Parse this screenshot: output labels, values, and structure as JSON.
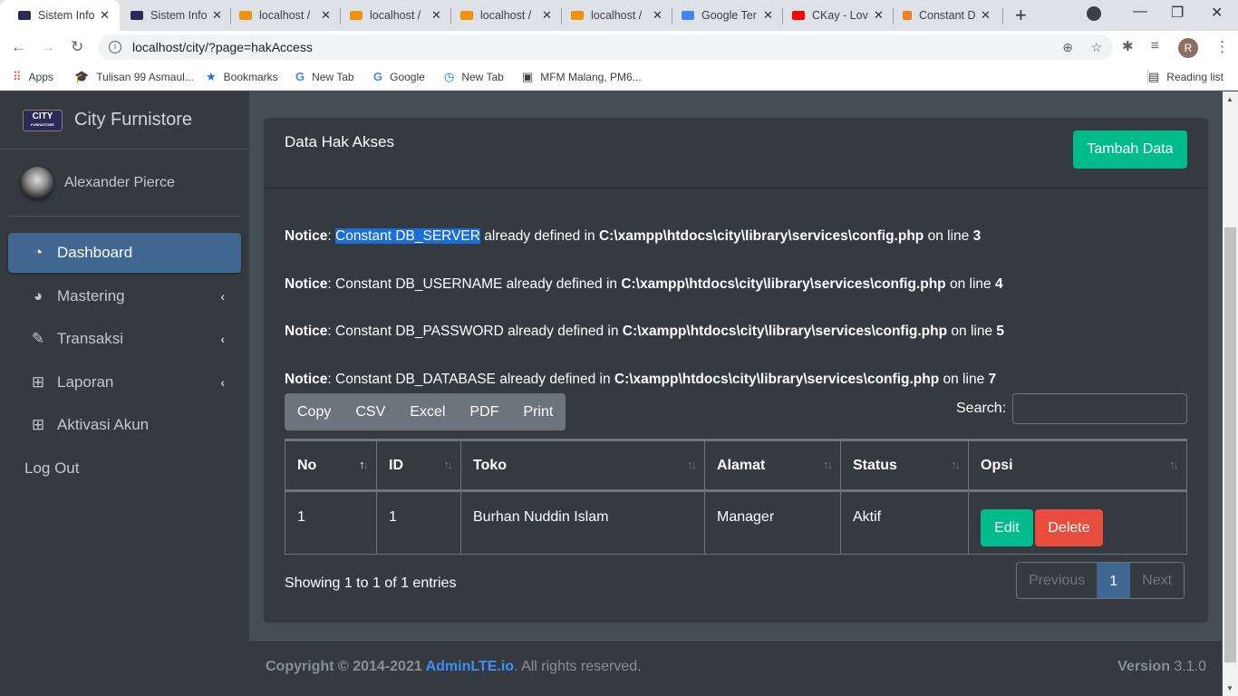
{
  "browser": {
    "tabs": [
      {
        "title": "Sistem Info",
        "icon": "city-favicon",
        "active": true
      },
      {
        "title": "Sistem Info",
        "icon": "city-favicon",
        "active": false
      },
      {
        "title": "localhost /",
        "icon": "pma-favicon",
        "active": false
      },
      {
        "title": "localhost /",
        "icon": "pma-favicon",
        "active": false
      },
      {
        "title": "localhost /",
        "icon": "pma-favicon",
        "active": false
      },
      {
        "title": "localhost /",
        "icon": "pma-favicon",
        "active": false
      },
      {
        "title": "Google Ter",
        "icon": "google-translate-favicon",
        "active": false
      },
      {
        "title": "CKay - Lov",
        "icon": "youtube-favicon",
        "active": false
      },
      {
        "title": "Constant D",
        "icon": "stackoverflow-favicon",
        "active": false
      }
    ],
    "url": "localhost/city/?page=hakAccess",
    "profile_initial": "R",
    "bookmarks": [
      {
        "label": "Apps",
        "icon": "apps-grid-icon"
      },
      {
        "label": "Tulisan 99 Asmaul...",
        "icon": "graduation-cap-icon"
      },
      {
        "label": "Bookmarks",
        "icon": "star-icon"
      },
      {
        "label": "New Tab",
        "icon": "google-icon"
      },
      {
        "label": "Google",
        "icon": "google-icon"
      },
      {
        "label": "New Tab",
        "icon": "history-icon"
      },
      {
        "label": "MFM Malang, PM6...",
        "icon": "site-icon"
      }
    ],
    "reading_list": "Reading list"
  },
  "sidebar": {
    "brand": "City Furnistore",
    "logo_text": "CITY",
    "logo_sub": "FURNISTORE",
    "user": "Alexander Pierce",
    "items": [
      {
        "label": "Dashboard",
        "icon": "tachometer-icon",
        "active": true,
        "has_children": false
      },
      {
        "label": "Mastering",
        "icon": "pie-chart-icon",
        "active": false,
        "has_children": true
      },
      {
        "label": "Transaksi",
        "icon": "edit-icon",
        "active": false,
        "has_children": true
      },
      {
        "label": "Laporan",
        "icon": "table-icon",
        "active": false,
        "has_children": true
      },
      {
        "label": "Aktivasi Akun",
        "icon": "table-icon",
        "active": false,
        "has_children": false
      }
    ],
    "logout": "Log Out"
  },
  "card": {
    "title": "Data Hak Akses",
    "add_button": "Tambah Data"
  },
  "notices": [
    {
      "label": "Notice",
      "pre": "Constant DB_SERVER",
      "msg": " already defined in ",
      "path": "C:\\xampp\\htdocs\\city\\library\\services\\config.php",
      "suffix": " on line ",
      "line": "3"
    },
    {
      "label": "Notice",
      "pre": "Constant DB_USERNAME",
      "msg": " already defined in ",
      "path": "C:\\xampp\\htdocs\\city\\library\\services\\config.php",
      "suffix": " on line ",
      "line": "4"
    },
    {
      "label": "Notice",
      "pre": "Constant DB_PASSWORD",
      "msg": " already defined in ",
      "path": "C:\\xampp\\htdocs\\city\\library\\services\\config.php",
      "suffix": " on line ",
      "line": "5"
    },
    {
      "label": "Notice",
      "pre": "Constant DB_DATABASE",
      "msg": " already defined in ",
      "path": "C:\\xampp\\htdocs\\city\\library\\services\\config.php",
      "suffix": " on line ",
      "line": "7"
    }
  ],
  "datatable": {
    "export_buttons": [
      "Copy",
      "CSV",
      "Excel",
      "PDF",
      "Print"
    ],
    "search_label": "Search:",
    "search_value": "",
    "columns": [
      "No",
      "ID",
      "Toko",
      "Alamat",
      "Status",
      "Opsi"
    ],
    "rows": [
      {
        "no": "1",
        "id": "1",
        "toko": "Burhan Nuddin Islam",
        "alamat": "Manager",
        "status": "Aktif",
        "edit": "Edit",
        "delete": "Delete"
      }
    ],
    "info": "Showing 1 to 1 of 1 entries",
    "pagination": {
      "previous": "Previous",
      "current": "1",
      "next": "Next"
    }
  },
  "footer": {
    "copyright": "Copyright © 2014-2021 ",
    "link": "AdminLTE.io",
    "rights": ". All rights reserved.",
    "version_label": "Version",
    "version": " 3.1.0"
  },
  "colors": {
    "accent_green": "#00bc8c",
    "danger": "#e74c3c",
    "active_blue": "#3f6791",
    "sidebar_bg": "#343a40"
  }
}
